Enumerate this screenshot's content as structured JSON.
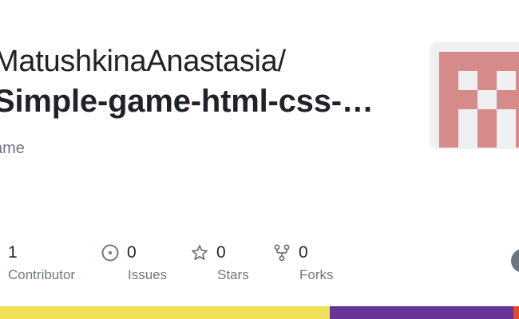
{
  "repo": {
    "owner": "MatushkinaAnastasia/",
    "name": "Simple-game-html-css-…",
    "description": "ame"
  },
  "stats": {
    "contributors": {
      "value": "1",
      "label": "Contributor",
      "icon": "people-icon"
    },
    "issues": {
      "value": "0",
      "label": "Issues",
      "icon": "issue-opened-icon"
    },
    "stars": {
      "value": "0",
      "label": "Stars",
      "icon": "star-icon"
    },
    "forks": {
      "value": "0",
      "label": "Forks",
      "icon": "repo-forked-icon"
    }
  },
  "avatar": {
    "icon": "identicon",
    "color": "#d68a8a",
    "background": "#eef0f2"
  },
  "languages": [
    {
      "color": "#f1e05a",
      "share": 0.636
    },
    {
      "color": "#663399",
      "share": 0.354
    },
    {
      "color": "#e34c26",
      "share": 0.01
    }
  ]
}
